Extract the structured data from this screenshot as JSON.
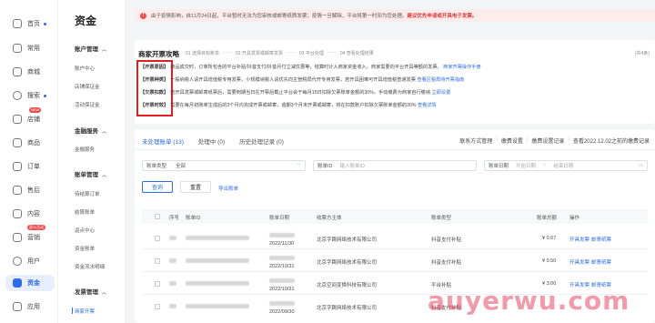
{
  "rail": {
    "items": [
      {
        "label": "首页",
        "dot": true
      },
      {
        "label": "常用"
      },
      {
        "label": "商城"
      },
      {
        "label": "搜索",
        "dot": true
      },
      {
        "label": "店铺",
        "tag": "NEW"
      },
      {
        "label": "商品"
      },
      {
        "label": "订单"
      },
      {
        "label": "售后"
      },
      {
        "label": "内容"
      },
      {
        "label": "营销",
        "tag": "双11活动"
      },
      {
        "label": "用户"
      },
      {
        "label": "资金",
        "active": true
      },
      {
        "label": "应用"
      }
    ]
  },
  "col2": {
    "title": "资金",
    "groups": [
      {
        "label": "账户管理",
        "items": [
          "账户中心",
          "店铺保证金",
          "活动保证金"
        ]
      },
      {
        "label": "金融服务",
        "items": [
          "金融服务"
        ]
      },
      {
        "label": "账单管理",
        "items": [
          "待结算订单",
          "结算账单",
          "返点中心",
          "资金账单",
          "资金流水明细"
        ]
      },
      {
        "label": "发票管理",
        "items": [
          "商家开票"
        ]
      }
    ]
  },
  "notice": {
    "text": "由于疫情影响，自11月24日起，平台暂时无法为您审核或邮寄纸质发票；疫情一旦解除，平台将第一时间为您处理。",
    "highlight": "建议优先申请或开具电子发票。"
  },
  "strategy": {
    "title": "商家开票攻略",
    "steps": [
      "01 选择目标账单",
      "02 开具发票或邮寄发票",
      "03 平台处理",
      "04 查看处理结果"
    ],
    "count": "(共4条)",
    "rules": [
      {
        "tag": "【开票原因】",
        "text": "商品成交时，订单所包含的平台补贴/抖音支付/抖音月付立减优惠等，结算时计入商家资金收入，商家需要向平台开具等额的发票。",
        "link": "商家开票操作手册"
      },
      {
        "tag": "【开票种类】",
        "text": "一般纳税人请开具增值税专用发票，小规模纳税人请优先向主管税局代开专用发票，若开具困难可开具增值税普通发票",
        "link": "查看区税局待开票指南"
      },
      {
        "tag": "【欠票扣款】",
        "text": "若开具发票或邮寄纸票后，需要到期当日在开票后截止平台会于每月15日扣除欠票账单金额的30%，手动缴费为商家自行缴纳",
        "link": "立即设置"
      },
      {
        "tag": "【开票时效】",
        "text": "需要在每月初账单生成后的3个月内完成开票或邮寄，逾期3个月未开票或邮寄，将在扣款账户扣除欠票账单金额的30%",
        "link": "查看详情"
      }
    ]
  },
  "tabs": [
    {
      "label": "未处理账单 (13)",
      "active": true
    },
    {
      "label": "处理中 (0)"
    },
    {
      "label": "历史处理记录 (0)"
    }
  ],
  "right_links": [
    "联系方式管理",
    "缴费设置",
    "缴费设置记录",
    "查看2022.12.02之前的缴费记录"
  ],
  "filters": {
    "bill_type_label": "账单类型",
    "bill_type_value": "全部",
    "bill_id_label": "账单ID",
    "bill_id_placeholder": "输入账单ID",
    "bill_date_label": "账单日期",
    "date_start": "开始日期",
    "date_sep": "~",
    "date_end": "结束日期",
    "query": "查询",
    "reset": "重置",
    "export": "导出账单"
  },
  "table": {
    "headers": [
      "序号",
      "账单ID",
      "账单日期",
      "收票方主体",
      "账单类型",
      "账单总额",
      "操作"
    ],
    "rows": [
      {
        "date": "2022/11/30",
        "payee": "北京字跳网络技术有限公司",
        "type": "抖音支付补贴",
        "amount": "¥ 0.07",
        "actions": [
          "开具发票",
          "邮寄纸票"
        ]
      },
      {
        "date": "2022/10/31",
        "payee": "北京字跳网络技术有限公司",
        "type": "抖音支付补贴",
        "amount": "¥ 0.50",
        "actions": [
          "开具发票",
          "邮寄纸票"
        ]
      },
      {
        "date": "2022/10/31",
        "payee": "北京空间变换科技有限公司",
        "type": "平台补贴",
        "amount": "¥ 3.00",
        "actions": [
          "开具发票",
          "邮寄纸票"
        ]
      },
      {
        "date": "2022/09/30",
        "payee": "北京字跳网络技术有限公司",
        "type": "抖音支付补贴",
        "amount": "",
        "actions": []
      }
    ]
  },
  "watermark": "auyerwu.com"
}
